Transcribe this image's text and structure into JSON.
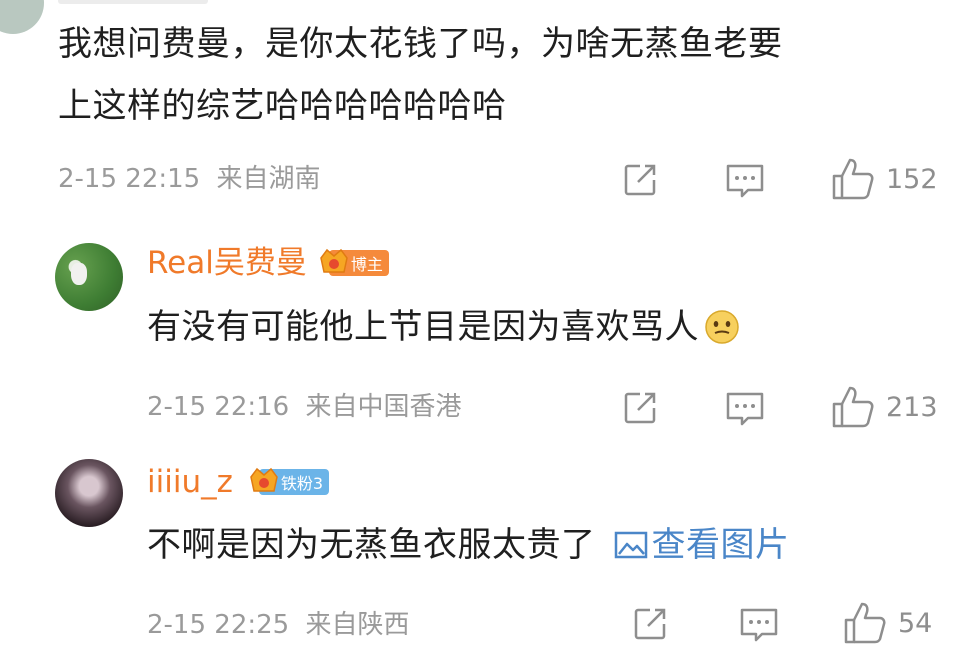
{
  "top_comment": {
    "text_line1": "我想问费曼，是你太花钱了吗，为啥无蒸鱼老要",
    "text_line2": "上这样的综艺哈哈哈哈哈哈哈",
    "time": "2-15 22:15",
    "location": "来自湖南",
    "likes": "152"
  },
  "replies": [
    {
      "username": "Real吴费曼",
      "badge": "博主",
      "badge_color": "#f58a3b",
      "text": "有没有可能他上节目是因为喜欢骂人",
      "emoji": "smirk-emoji",
      "time": "2-15 22:16",
      "location": "来自中国香港",
      "likes": "213"
    },
    {
      "username": "iiiiu_z",
      "badge": "铁粉3",
      "badge_color": "#6bb4e8",
      "text": "不啊是因为无蒸鱼衣服太贵了",
      "image_link": "查看图片",
      "time": "2-15 22:25",
      "location": "来自陕西",
      "likes": "54"
    }
  ],
  "icons": {
    "share": "share-icon",
    "comment": "comment-icon",
    "like": "thumbs-up-icon",
    "image": "image-icon"
  },
  "colors": {
    "username": "#f07a2a",
    "meta": "#9a9a9a",
    "link": "#4a86c8"
  }
}
